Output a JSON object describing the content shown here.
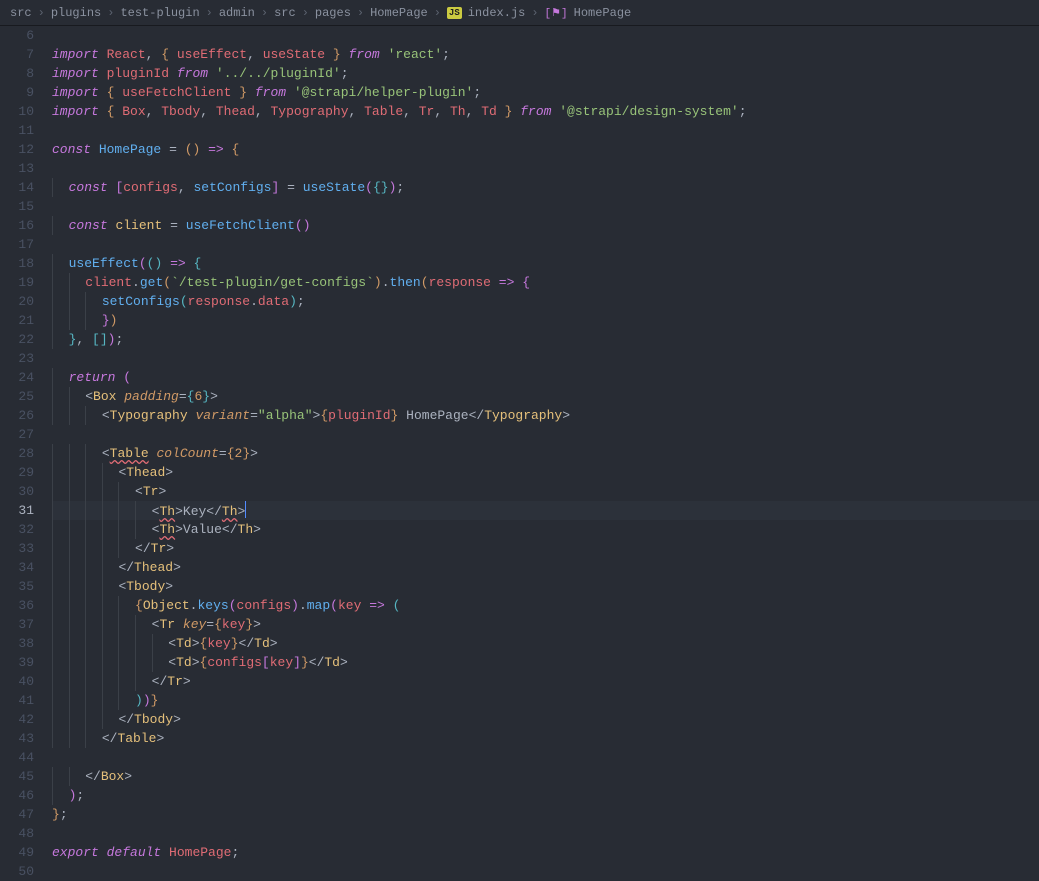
{
  "breadcrumb": {
    "items": [
      "src",
      "plugins",
      "test-plugin",
      "admin",
      "src",
      "pages",
      "HomePage",
      "index.js",
      "HomePage"
    ],
    "jsIconLabel": "JS",
    "symIcon": "⚑"
  },
  "gutter": {
    "start": 6,
    "end": 50,
    "active": 31
  },
  "code": {
    "l6": "",
    "l7": {
      "import": "import",
      "React": "React",
      "useEffect": "useEffect",
      "useState": "useState",
      "from": "from",
      "mod": "'react'"
    },
    "l8": {
      "import": "import",
      "pluginId": "pluginId",
      "from": "from",
      "mod": "'../../pluginId'"
    },
    "l9": {
      "import": "import",
      "useFetchClient": "useFetchClient",
      "from": "from",
      "mod": "'@strapi/helper-plugin'"
    },
    "l10": {
      "import": "import",
      "names": [
        "Box",
        "Tbody",
        "Thead",
        "Typography",
        "Table",
        "Tr",
        "Th",
        "Td"
      ],
      "from": "from",
      "mod": "'@strapi/design-system'"
    },
    "l11": "",
    "l12": {
      "const": "const",
      "HomePage": "HomePage",
      "arrow": "=>"
    },
    "l13": "",
    "l14": {
      "const": "const",
      "configs": "configs",
      "setConfigs": "setConfigs",
      "useState": "useState"
    },
    "l15": "",
    "l16": {
      "const": "const",
      "client": "client",
      "useFetchClient": "useFetchClient"
    },
    "l17": "",
    "l18": {
      "useEffect": "useEffect",
      "arrow": "=>"
    },
    "l19": {
      "client": "client",
      "get": "get",
      "url": "`/test-plugin/get-configs`",
      "then": "then",
      "response": "response",
      "arrow": "=>"
    },
    "l20": {
      "setConfigs": "setConfigs",
      "response": "response",
      "data": "data"
    },
    "l21": "",
    "l22": "",
    "l23": "",
    "l24": {
      "return": "return"
    },
    "l25": {
      "Box": "Box",
      "padding": "padding",
      "val": "6"
    },
    "l26": {
      "Typography": "Typography",
      "variant": "variant",
      "alpha": "\"alpha\"",
      "pluginId": "pluginId",
      "HomePageText": " HomePage"
    },
    "l27": "",
    "l28": {
      "Table": "Table",
      "colCount": "colCount",
      "val": "2"
    },
    "l29": {
      "Thead": "Thead"
    },
    "l30": {
      "Tr": "Tr"
    },
    "l31": {
      "Th": "Th",
      "Key": "Key"
    },
    "l32": {
      "Th": "Th",
      "Value": "Value"
    },
    "l33": {
      "Tr": "Tr"
    },
    "l34": {
      "Thead": "Thead"
    },
    "l35": {
      "Tbody": "Tbody"
    },
    "l36": {
      "Object": "Object",
      "keys": "keys",
      "configs": "configs",
      "map": "map",
      "key": "key",
      "arrow": "=>"
    },
    "l37": {
      "Tr": "Tr",
      "keyAttr": "key",
      "key": "key"
    },
    "l38": {
      "Td": "Td",
      "key": "key"
    },
    "l39": {
      "Td": "Td",
      "configs": "configs",
      "key": "key"
    },
    "l40": {
      "Tr": "Tr"
    },
    "l41": "",
    "l42": {
      "Tbody": "Tbody"
    },
    "l43": {
      "Table": "Table"
    },
    "l44": "",
    "l45": {
      "Box": "Box"
    },
    "l46": "",
    "l47": "",
    "l48": "",
    "l49": {
      "export": "export",
      "default": "default",
      "HomePage": "HomePage"
    },
    "l50": ""
  }
}
